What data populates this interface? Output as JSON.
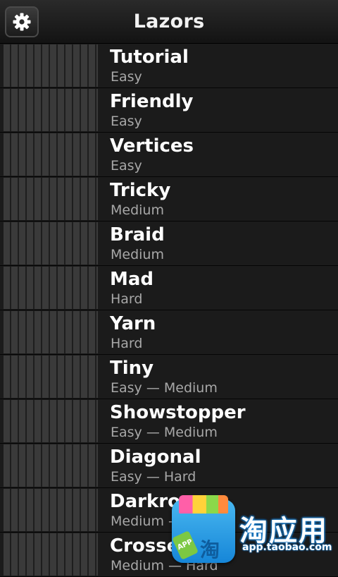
{
  "header": {
    "title": "Lazors",
    "settings_icon": "gear-icon"
  },
  "levels": [
    {
      "name": "Tutorial",
      "difficulty": "Easy"
    },
    {
      "name": "Friendly",
      "difficulty": "Easy"
    },
    {
      "name": "Vertices",
      "difficulty": "Easy"
    },
    {
      "name": "Tricky",
      "difficulty": "Medium"
    },
    {
      "name": "Braid",
      "difficulty": "Medium"
    },
    {
      "name": "Mad",
      "difficulty": "Hard"
    },
    {
      "name": "Yarn",
      "difficulty": "Hard"
    },
    {
      "name": "Tiny",
      "difficulty": "Easy — Medium"
    },
    {
      "name": "Showstopper",
      "difficulty": "Easy — Medium"
    },
    {
      "name": "Diagonal",
      "difficulty": "Easy — Hard"
    },
    {
      "name": "Darkroom",
      "difficulty": "Medium — Hard"
    },
    {
      "name": "Crossed",
      "difficulty": "Medium — Hard"
    }
  ],
  "overlay": {
    "brand": "淘应用",
    "url": "app.taobao.com",
    "tag": "APP",
    "bag_char": "淘"
  }
}
